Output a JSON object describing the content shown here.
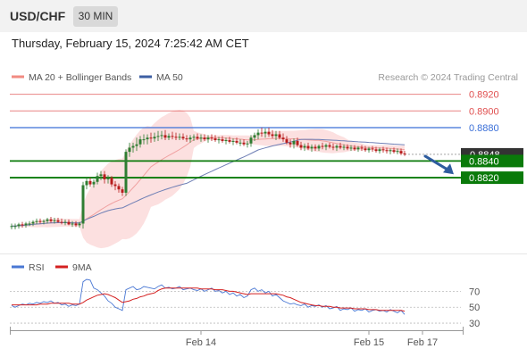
{
  "header": {
    "pair": "USD/CHF",
    "timeframe": "30 MIN",
    "timestamp": "Thursday, February 15, 2024 7:25:42 AM CET"
  },
  "legend": {
    "items": [
      {
        "label": "MA 20 + Bollinger Bands",
        "color": "#f28b82"
      },
      {
        "label": "MA 50",
        "color": "#3d5fa3"
      }
    ],
    "copyright": "Research © 2024 Trading Central"
  },
  "colors": {
    "up": "#2e7d32",
    "down": "#b71c1c",
    "resistance": "#e05050",
    "pivot": "#3a6fd8",
    "support": "#0a7a0a",
    "band": "#fbd5d5",
    "ma20": "#f0a0a0",
    "ma50": "#6f7fb5",
    "rsi": "#4a78d4",
    "rsi_ma": "#d42020",
    "current": "#333333"
  },
  "chart_data": [
    {
      "type": "candlestick",
      "y_min": 0.8742,
      "y_max": 0.8926,
      "x_ticks": [
        {
          "label": "Feb 14",
          "index": 53
        },
        {
          "label": "Feb 15",
          "index": 100
        },
        {
          "label": "Feb 17",
          "index": 115
        }
      ],
      "ohlc": [
        [
          0.8762,
          0.8765,
          0.8758,
          0.8762
        ],
        [
          0.8762,
          0.8765,
          0.8758,
          0.8762
        ],
        [
          0.8762,
          0.8766,
          0.8759,
          0.8764
        ],
        [
          0.8764,
          0.8767,
          0.876,
          0.8763
        ],
        [
          0.8763,
          0.8767,
          0.876,
          0.8765
        ],
        [
          0.8765,
          0.8768,
          0.8762,
          0.8765
        ],
        [
          0.8765,
          0.8769,
          0.8762,
          0.8767
        ],
        [
          0.8767,
          0.8771,
          0.8764,
          0.8768
        ],
        [
          0.8768,
          0.8771,
          0.8765,
          0.8767
        ],
        [
          0.8767,
          0.877,
          0.8764,
          0.8768
        ],
        [
          0.8768,
          0.8772,
          0.8765,
          0.877
        ],
        [
          0.877,
          0.8773,
          0.8766,
          0.8768
        ],
        [
          0.8768,
          0.8772,
          0.8765,
          0.8769
        ],
        [
          0.8769,
          0.8772,
          0.8766,
          0.8767
        ],
        [
          0.8767,
          0.8771,
          0.8764,
          0.8766
        ],
        [
          0.8766,
          0.877,
          0.8763,
          0.8767
        ],
        [
          0.8767,
          0.877,
          0.8763,
          0.8764
        ],
        [
          0.8764,
          0.8768,
          0.8761,
          0.8765
        ],
        [
          0.8765,
          0.8768,
          0.8761,
          0.8763
        ],
        [
          0.8763,
          0.8767,
          0.876,
          0.8765
        ],
        [
          0.8765,
          0.8815,
          0.8759,
          0.8811
        ],
        [
          0.8811,
          0.882,
          0.8806,
          0.8816
        ],
        [
          0.8816,
          0.882,
          0.8809,
          0.8812
        ],
        [
          0.8812,
          0.8818,
          0.8808,
          0.8815
        ],
        [
          0.8815,
          0.8826,
          0.8812,
          0.8822
        ],
        [
          0.8822,
          0.8828,
          0.8817,
          0.8824
        ],
        [
          0.8824,
          0.8828,
          0.8813,
          0.8818
        ],
        [
          0.8818,
          0.8823,
          0.8813,
          0.882
        ],
        [
          0.882,
          0.8822,
          0.8809,
          0.8812
        ],
        [
          0.8812,
          0.8816,
          0.8805,
          0.881
        ],
        [
          0.881,
          0.8813,
          0.8802,
          0.8806
        ],
        [
          0.8806,
          0.8809,
          0.8798,
          0.8802
        ],
        [
          0.8802,
          0.8854,
          0.8798,
          0.8851
        ],
        [
          0.8851,
          0.8862,
          0.8845,
          0.8856
        ],
        [
          0.8856,
          0.8862,
          0.885,
          0.8858
        ],
        [
          0.8858,
          0.8868,
          0.8852,
          0.886
        ],
        [
          0.886,
          0.887,
          0.8856,
          0.8866
        ],
        [
          0.8866,
          0.8872,
          0.886,
          0.8866
        ],
        [
          0.8866,
          0.8872,
          0.886,
          0.8868
        ],
        [
          0.8868,
          0.8874,
          0.8862,
          0.8867
        ],
        [
          0.8867,
          0.8874,
          0.8863,
          0.8869
        ],
        [
          0.8869,
          0.8876,
          0.8864,
          0.887
        ],
        [
          0.887,
          0.8876,
          0.8866,
          0.8871
        ],
        [
          0.8871,
          0.8877,
          0.8865,
          0.8868
        ],
        [
          0.8868,
          0.8873,
          0.8865,
          0.887
        ],
        [
          0.887,
          0.8875,
          0.8866,
          0.8869
        ],
        [
          0.8869,
          0.8874,
          0.8865,
          0.8868
        ],
        [
          0.8868,
          0.8873,
          0.8865,
          0.8869
        ],
        [
          0.8869,
          0.8873,
          0.8865,
          0.8867
        ],
        [
          0.8867,
          0.8871,
          0.8863,
          0.8866
        ],
        [
          0.8866,
          0.8871,
          0.8862,
          0.8868
        ],
        [
          0.8868,
          0.8872,
          0.8864,
          0.8869
        ],
        [
          0.8869,
          0.8873,
          0.8865,
          0.8867
        ],
        [
          0.8867,
          0.8872,
          0.8863,
          0.8868
        ],
        [
          0.8868,
          0.8872,
          0.8864,
          0.8866
        ],
        [
          0.8866,
          0.8871,
          0.8862,
          0.8868
        ],
        [
          0.8868,
          0.8872,
          0.8864,
          0.8867
        ],
        [
          0.8867,
          0.8871,
          0.8863,
          0.8865
        ],
        [
          0.8865,
          0.8869,
          0.8861,
          0.8866
        ],
        [
          0.8866,
          0.887,
          0.8862,
          0.8864
        ],
        [
          0.8864,
          0.8868,
          0.886,
          0.8865
        ],
        [
          0.8865,
          0.8869,
          0.8861,
          0.8863
        ],
        [
          0.8863,
          0.8867,
          0.8859,
          0.8864
        ],
        [
          0.8864,
          0.8868,
          0.886,
          0.8862
        ],
        [
          0.8862,
          0.8866,
          0.8858,
          0.8862
        ],
        [
          0.8862,
          0.8866,
          0.8858,
          0.886
        ],
        [
          0.886,
          0.8864,
          0.8856,
          0.8861
        ],
        [
          0.8861,
          0.8871,
          0.8857,
          0.8868
        ],
        [
          0.8868,
          0.8874,
          0.8864,
          0.8871
        ],
        [
          0.8871,
          0.8878,
          0.8866,
          0.8874
        ],
        [
          0.8874,
          0.888,
          0.8869,
          0.8873
        ],
        [
          0.8873,
          0.8879,
          0.8868,
          0.8875
        ],
        [
          0.8875,
          0.888,
          0.8869,
          0.8872
        ],
        [
          0.8872,
          0.8877,
          0.8867,
          0.887
        ],
        [
          0.887,
          0.8876,
          0.8865,
          0.8872
        ],
        [
          0.8872,
          0.8876,
          0.8866,
          0.8868
        ],
        [
          0.8868,
          0.8873,
          0.8863,
          0.8866
        ],
        [
          0.8866,
          0.887,
          0.886,
          0.8862
        ],
        [
          0.8862,
          0.8866,
          0.8856,
          0.886
        ],
        [
          0.886,
          0.8867,
          0.8855,
          0.8864
        ],
        [
          0.8864,
          0.8868,
          0.8857,
          0.8859
        ],
        [
          0.8859,
          0.8863,
          0.8853,
          0.8856
        ],
        [
          0.8856,
          0.8861,
          0.8852,
          0.8858
        ],
        [
          0.8858,
          0.8862,
          0.8853,
          0.8855
        ],
        [
          0.8855,
          0.886,
          0.8851,
          0.8857
        ],
        [
          0.8857,
          0.886,
          0.8852,
          0.8855
        ],
        [
          0.8855,
          0.886,
          0.8852,
          0.8858
        ],
        [
          0.8858,
          0.8862,
          0.8854,
          0.8857
        ],
        [
          0.8857,
          0.8861,
          0.8853,
          0.8859
        ],
        [
          0.8859,
          0.8862,
          0.8855,
          0.8857
        ],
        [
          0.8857,
          0.8861,
          0.8853,
          0.8856
        ],
        [
          0.8856,
          0.886,
          0.8852,
          0.8858
        ],
        [
          0.8858,
          0.8862,
          0.8854,
          0.8856
        ],
        [
          0.8856,
          0.886,
          0.8853,
          0.8857
        ],
        [
          0.8857,
          0.886,
          0.8853,
          0.8855
        ],
        [
          0.8855,
          0.8859,
          0.8852,
          0.8856
        ],
        [
          0.8856,
          0.8859,
          0.8852,
          0.8854
        ],
        [
          0.8854,
          0.8858,
          0.8851,
          0.8856
        ],
        [
          0.8856,
          0.8859,
          0.8852,
          0.8855
        ],
        [
          0.8855,
          0.8858,
          0.8851,
          0.8853
        ],
        [
          0.8853,
          0.8857,
          0.885,
          0.8855
        ],
        [
          0.8855,
          0.8858,
          0.8851,
          0.8854
        ],
        [
          0.8854,
          0.8857,
          0.885,
          0.8852
        ],
        [
          0.8852,
          0.8856,
          0.8849,
          0.8854
        ],
        [
          0.8854,
          0.8857,
          0.885,
          0.8853
        ],
        [
          0.8853,
          0.8856,
          0.8849,
          0.8852
        ],
        [
          0.8852,
          0.8855,
          0.8848,
          0.8853
        ],
        [
          0.8853,
          0.8856,
          0.8849,
          0.8851
        ],
        [
          0.8851,
          0.8855,
          0.8848,
          0.8852
        ],
        [
          0.8852,
          0.8855,
          0.8847,
          0.8849
        ],
        [
          0.8849,
          0.8852,
          0.8846,
          0.8848
        ]
      ],
      "levels": [
        {
          "value": 0.892,
          "label": "0.8920",
          "kind": "resistance"
        },
        {
          "value": 0.89,
          "label": "0.8900",
          "kind": "resistance"
        },
        {
          "value": 0.888,
          "label": "0.8880",
          "kind": "pivot"
        },
        {
          "value": 0.8848,
          "label": "0.8848",
          "kind": "current"
        },
        {
          "value": 0.884,
          "label": "0.8840",
          "kind": "support"
        },
        {
          "value": 0.882,
          "label": "0.8820",
          "kind": "support"
        }
      ],
      "forecast_arrow": {
        "from": 0.8848,
        "to": 0.8822,
        "direction": "down"
      }
    },
    {
      "type": "line",
      "title": "RSI",
      "series": [
        {
          "name": "RSI",
          "values": [
            52,
            50,
            52,
            54,
            53,
            55,
            54,
            56,
            55,
            57,
            56,
            58,
            55,
            56,
            53,
            54,
            51,
            53,
            52,
            54,
            82,
            85,
            84,
            74,
            72,
            68,
            64,
            58,
            55,
            50,
            48,
            46,
            72,
            74,
            76,
            72,
            73,
            76,
            75,
            74,
            73,
            76,
            78,
            74,
            75,
            73,
            74,
            76,
            72,
            73,
            74,
            72,
            71,
            73,
            70,
            72,
            74,
            70,
            71,
            68,
            70,
            66,
            68,
            64,
            66,
            62,
            64,
            72,
            74,
            70,
            72,
            68,
            70,
            64,
            66,
            62,
            58,
            56,
            54,
            55,
            53,
            52,
            54,
            50,
            52,
            51,
            53,
            50,
            52,
            48,
            49,
            51,
            46,
            48,
            47,
            49,
            45,
            47,
            46,
            48,
            44,
            46,
            47,
            45,
            46,
            44,
            47,
            45,
            43,
            46,
            41
          ]
        },
        {
          "name": "9MA",
          "values": [
            53,
            53,
            53,
            53,
            53,
            53,
            53,
            53,
            54,
            54,
            54,
            55,
            55,
            55,
            55,
            55,
            55,
            54,
            54,
            54,
            56,
            59,
            61,
            63,
            65,
            66,
            67,
            66,
            64,
            62,
            59,
            56,
            57,
            58,
            60,
            61,
            63,
            64,
            66,
            67,
            68,
            71,
            73,
            74,
            74,
            74,
            74,
            74,
            74,
            74,
            74,
            74,
            74,
            73,
            73,
            73,
            73,
            72,
            72,
            72,
            71,
            70,
            70,
            69,
            68,
            67,
            66,
            67,
            67,
            67,
            67,
            67,
            67,
            67,
            67,
            66,
            65,
            63,
            62,
            60,
            58,
            56,
            55,
            54,
            53,
            52,
            52,
            51,
            51,
            51,
            50,
            50,
            49,
            49,
            49,
            49,
            48,
            48,
            48,
            48,
            47,
            47,
            47,
            46,
            46,
            46,
            46,
            46,
            46,
            46,
            45
          ]
        }
      ],
      "y_ticks": [
        {
          "value": 70,
          "label": "70"
        },
        {
          "value": 50,
          "label": "50"
        },
        {
          "value": 30,
          "label": "30"
        }
      ]
    }
  ]
}
